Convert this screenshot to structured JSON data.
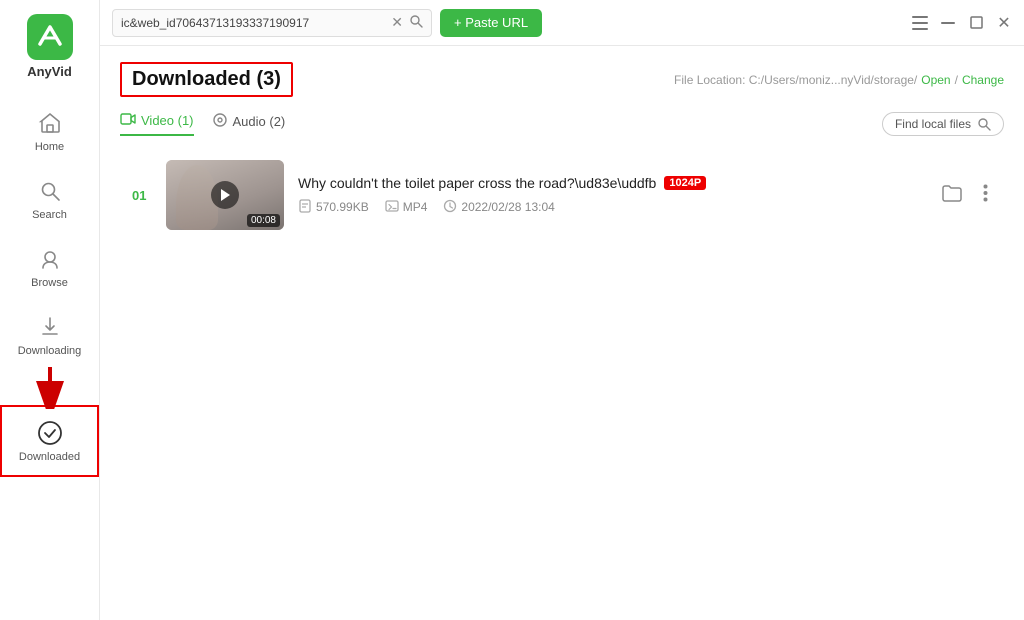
{
  "app": {
    "name": "AnyVid",
    "logo_text": "A"
  },
  "titlebar": {
    "url_text": "ic&web_id70643713193337190917",
    "paste_btn_label": "+ Paste URL",
    "window_controls": [
      "hamburger",
      "minimize",
      "maximize",
      "close"
    ]
  },
  "sidebar": {
    "items": [
      {
        "id": "home",
        "label": "Home",
        "icon": "home-icon"
      },
      {
        "id": "search",
        "label": "Search",
        "icon": "search-icon"
      },
      {
        "id": "browse",
        "label": "Browse",
        "icon": "browse-icon"
      },
      {
        "id": "downloading",
        "label": "Downloading",
        "icon": "downloading-icon"
      },
      {
        "id": "downloaded",
        "label": "Downloaded",
        "icon": "downloaded-icon",
        "active": true
      }
    ]
  },
  "page": {
    "title": "Downloaded (3)",
    "file_location_label": "File Location: C:/Users/moniz...nyVid/storage/",
    "open_label": "Open",
    "change_label": "Change"
  },
  "tabs": [
    {
      "id": "video",
      "label": "Video (1)",
      "active": true
    },
    {
      "id": "audio",
      "label": "Audio (2)",
      "active": false
    }
  ],
  "find_local": {
    "label": "Find local files",
    "placeholder": "Find local files"
  },
  "videos": [
    {
      "number": "01",
      "title": "Why couldn't the toilet paper cross the road?\\ud83e\\uddfb",
      "quality": "1024P",
      "size": "570.99KB",
      "format": "MP4",
      "date": "2022/02/28 13:04",
      "duration": "00:08"
    }
  ]
}
